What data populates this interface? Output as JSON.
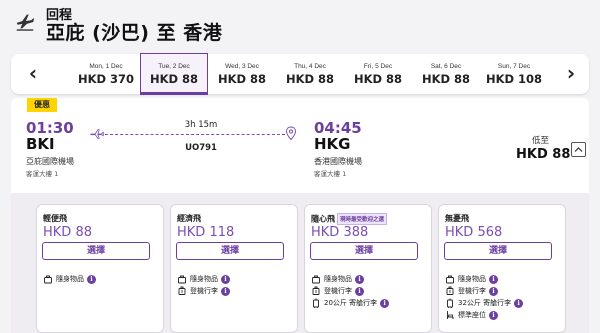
{
  "header": {
    "subtitle": "回程",
    "title": "亞庇 (沙巴) 至 香港"
  },
  "dates": [
    {
      "date": "Mon, 1 Dec",
      "price": "HKD 370",
      "active": false
    },
    {
      "date": "Tue, 2 Dec",
      "price": "HKD 88",
      "active": true
    },
    {
      "date": "Wed, 3 Dec",
      "price": "HKD 88",
      "active": false
    },
    {
      "date": "Thu, 4 Dec",
      "price": "HKD 88",
      "active": false
    },
    {
      "date": "Fri, 5 Dec",
      "price": "HKD 88",
      "active": false
    },
    {
      "date": "Sat, 6 Dec",
      "price": "HKD 88",
      "active": false
    },
    {
      "date": "Sun, 7 Dec",
      "price": "HKD 108",
      "active": false
    }
  ],
  "flight": {
    "promo": "優惠",
    "departure": {
      "time": "01:30",
      "code": "BKI",
      "airport": "亞庇國際機場",
      "terminal": "客運大樓 1"
    },
    "arrival": {
      "time": "04:45",
      "code": "HKG",
      "airport": "香港國際機場",
      "terminal": "客運大樓 1"
    },
    "duration": "3h 15m",
    "flight_no": "UO791",
    "lowest_label": "低至",
    "lowest_price": "HKD 88"
  },
  "fares": [
    {
      "name": "輕便飛",
      "tag": "",
      "price": "HKD 88",
      "select": "選擇",
      "features": [
        {
          "icon": "bag-icon",
          "text": "隨身物品"
        }
      ]
    },
    {
      "name": "經濟飛",
      "tag": "",
      "price": "HKD 118",
      "select": "選擇",
      "features": [
        {
          "icon": "bag-icon",
          "text": "隨身物品"
        },
        {
          "icon": "cabin-bag-icon",
          "text": "登機行李"
        }
      ]
    },
    {
      "name": "隨心飛",
      "tag": "現時最受歡迎之選",
      "price": "HKD 388",
      "select": "選擇",
      "features": [
        {
          "icon": "bag-icon",
          "text": "隨身物品"
        },
        {
          "icon": "cabin-bag-icon",
          "text": "登機行李"
        },
        {
          "icon": "suitcase-icon",
          "text": "20公斤 寄艙行李"
        }
      ]
    },
    {
      "name": "無憂飛",
      "tag": "",
      "price": "HKD 568",
      "select": "選擇",
      "features": [
        {
          "icon": "bag-icon",
          "text": "隨身物品"
        },
        {
          "icon": "cabin-bag-icon",
          "text": "登機行李"
        },
        {
          "icon": "suitcase-icon",
          "text": "32公斤 寄艙行李"
        },
        {
          "icon": "seat-icon",
          "text": "標準座位"
        }
      ]
    }
  ],
  "colors": {
    "accent": "#6b3fa0",
    "promo": "#ffd400"
  }
}
